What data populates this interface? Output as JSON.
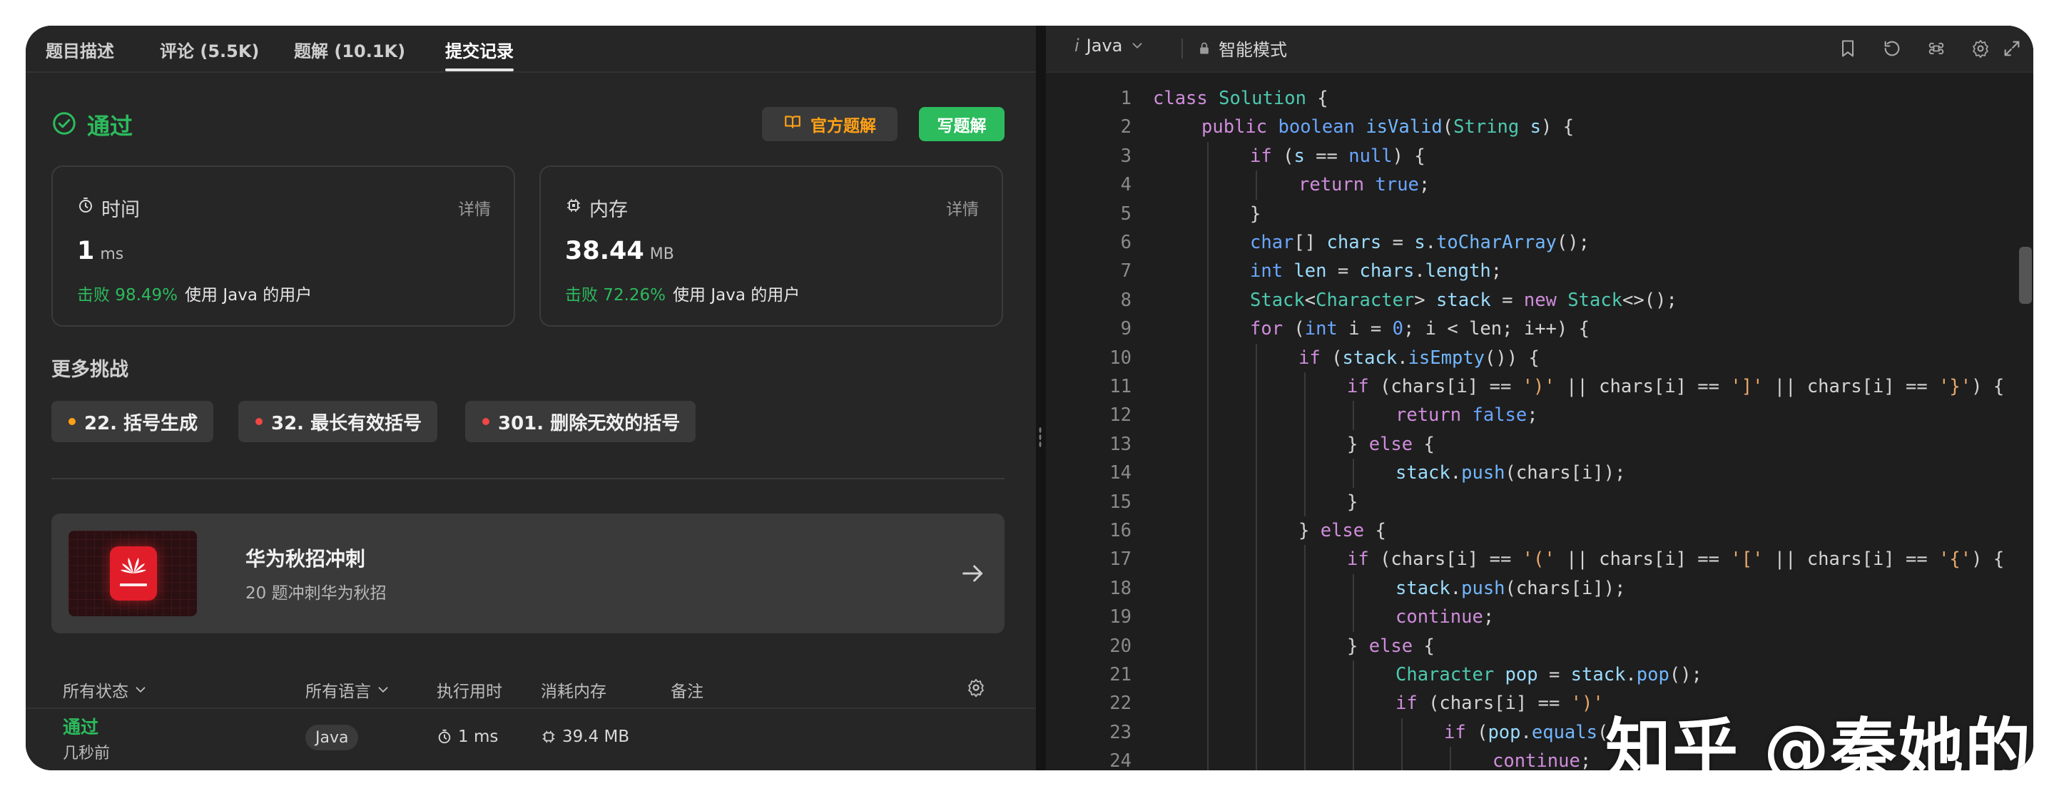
{
  "tabs": [
    {
      "label": "题目描述"
    },
    {
      "label": "评论 (5.5K)"
    },
    {
      "label": "题解 (10.1K)"
    },
    {
      "label": "提交记录"
    }
  ],
  "result": {
    "status": "通过",
    "official_solution": "官方题解",
    "write_solution": "写题解"
  },
  "runtime": {
    "title": "时间",
    "detail": "详情",
    "value": "1",
    "unit": "ms",
    "beat": "击败 98.49%",
    "suffix": "使用 Java 的用户"
  },
  "memory": {
    "title": "内存",
    "detail": "详情",
    "value": "38.44",
    "unit": "MB",
    "beat": "击败 72.26%",
    "suffix": "使用 Java 的用户"
  },
  "more": {
    "title": "更多挑战",
    "items": [
      {
        "label": "22. 括号生成",
        "color": "#ffa116"
      },
      {
        "label": "32. 最长有效括号",
        "color": "#ef4743"
      },
      {
        "label": "301. 删除无效的括号",
        "color": "#ef4743"
      }
    ]
  },
  "promo": {
    "title": "华为秋招冲刺",
    "subtitle": "20 题冲刺华为秋招"
  },
  "table": {
    "headers": {
      "status": "所有状态",
      "language": "所有语言",
      "runtime": "执行用时",
      "memory": "消耗内存",
      "notes": "备注"
    },
    "row": {
      "status": "通过",
      "time": "几秒前",
      "language": "Java",
      "runtime": "1 ms",
      "memory": "39.4 MB"
    }
  },
  "editor": {
    "language": "Java",
    "mode": "智能模式"
  },
  "code_lines": [
    {
      "n": 1,
      "indent": 0,
      "html": "<span class='kw'>class</span> <span class='ty'>Solution</span> {"
    },
    {
      "n": 2,
      "indent": 1,
      "html": "<span class='kw'>public</span> <span class='kw2'>boolean</span> <span class='fn'>isValid</span>(<span class='ty'>String</span> <span class='var'>s</span>) {"
    },
    {
      "n": 3,
      "indent": 2,
      "html": "<span class='kw'>if</span> (<span class='var'>s</span> == <span class='lit'>null</span>) {"
    },
    {
      "n": 4,
      "indent": 3,
      "html": "<span class='kw'>return</span> <span class='lit'>true</span>;"
    },
    {
      "n": 5,
      "indent": 2,
      "html": "}"
    },
    {
      "n": 6,
      "indent": 2,
      "html": "<span class='kw2'>char</span>[] <span class='var'>chars</span> = <span class='var'>s</span>.<span class='fn'>toCharArray</span>();"
    },
    {
      "n": 7,
      "indent": 2,
      "html": "<span class='kw2'>int</span> <span class='var'>len</span> = <span class='var'>chars</span>.<span class='var'>length</span>;"
    },
    {
      "n": 8,
      "indent": 2,
      "html": "<span class='ty'>Stack</span>&lt;<span class='ty'>Character</span>&gt; <span class='var'>stack</span> = <span class='kw'>new</span> <span class='ty'>Stack</span>&lt;&gt;();"
    },
    {
      "n": 9,
      "indent": 2,
      "html": "<span class='kw'>for</span> (<span class='kw2'>int</span> i = <span class='lit'>0</span>; i &lt; len; i++) {"
    },
    {
      "n": 10,
      "indent": 3,
      "html": "<span class='kw'>if</span> (<span class='var'>stack</span>.<span class='fn'>isEmpty</span>()) {"
    },
    {
      "n": 11,
      "indent": 4,
      "html": "<span class='kw'>if</span> (chars[i] == <span class='str'>')'</span> || chars[i] == <span class='str'>']'</span> || chars[i] == <span class='str'>'}'</span>) {"
    },
    {
      "n": 12,
      "indent": 5,
      "html": "<span class='kw'>return</span> <span class='lit'>false</span>;"
    },
    {
      "n": 13,
      "indent": 4,
      "html": "} <span class='kw'>else</span> {"
    },
    {
      "n": 14,
      "indent": 5,
      "html": "<span class='var'>stack</span>.<span class='fn'>push</span>(chars[i]);"
    },
    {
      "n": 15,
      "indent": 4,
      "html": "}"
    },
    {
      "n": 16,
      "indent": 3,
      "html": "} <span class='kw'>else</span> {"
    },
    {
      "n": 17,
      "indent": 4,
      "html": "<span class='kw'>if</span> (chars[i] == <span class='str'>'('</span> || chars[i] == <span class='str'>'['</span> || chars[i] == <span class='str'>'{'</span>) {"
    },
    {
      "n": 18,
      "indent": 5,
      "html": "<span class='var'>stack</span>.<span class='fn'>push</span>(chars[i]);"
    },
    {
      "n": 19,
      "indent": 5,
      "html": "<span class='kw'>continue</span>;"
    },
    {
      "n": 20,
      "indent": 4,
      "html": "} <span class='kw'>else</span> {"
    },
    {
      "n": 21,
      "indent": 5,
      "html": "<span class='ty'>Character</span> <span class='var'>pop</span> = <span class='var'>stack</span>.<span class='fn'>pop</span>();"
    },
    {
      "n": 22,
      "indent": 5,
      "html": "<span class='kw'>if</span> (chars[i] == <span class='str'>')'</span>"
    },
    {
      "n": 23,
      "indent": 6,
      "html": "<span class='kw'>if</span> (<span class='var'>pop</span>.<span class='fn'>equals</span>("
    },
    {
      "n": 24,
      "indent": 7,
      "html": "<span class='kw'>continue</span>;"
    }
  ],
  "watermark": "知乎 @秦她的菜"
}
